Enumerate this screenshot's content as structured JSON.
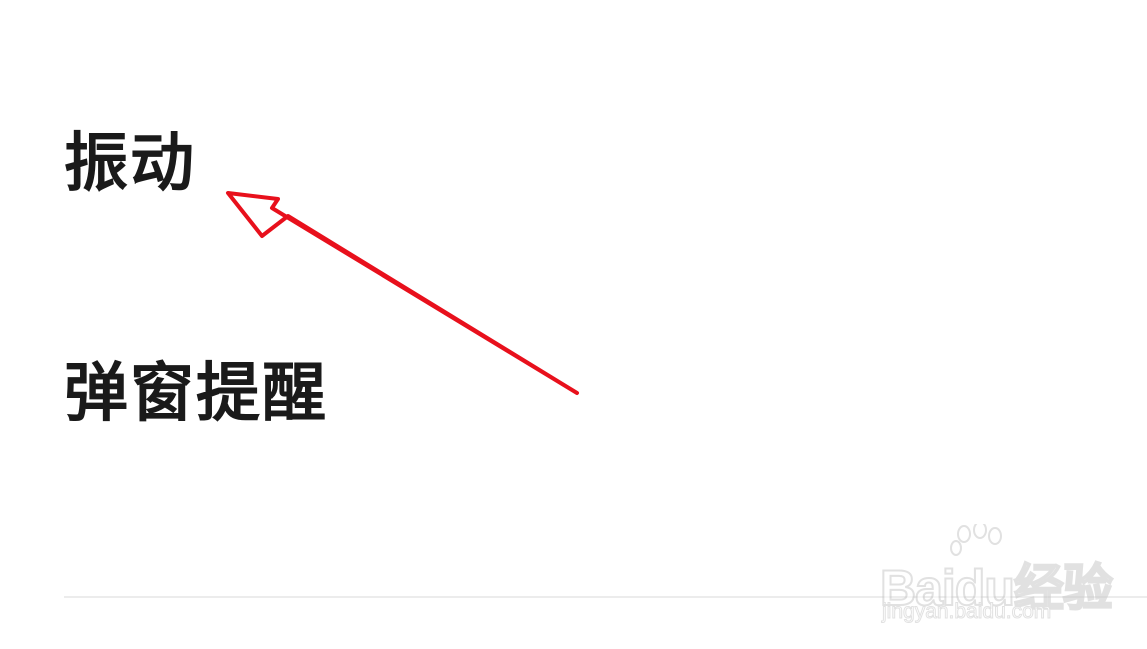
{
  "settings": {
    "items": [
      {
        "label": "振动"
      },
      {
        "label": "弹窗提醒"
      }
    ]
  },
  "annotation": {
    "arrow_color": "#e8101c",
    "arrow_icon": "red-arrow-icon"
  },
  "watermark": {
    "brand": "Baidu经验",
    "url": "jingyan.baidu.com",
    "icon": "baidu-paw-icon"
  }
}
